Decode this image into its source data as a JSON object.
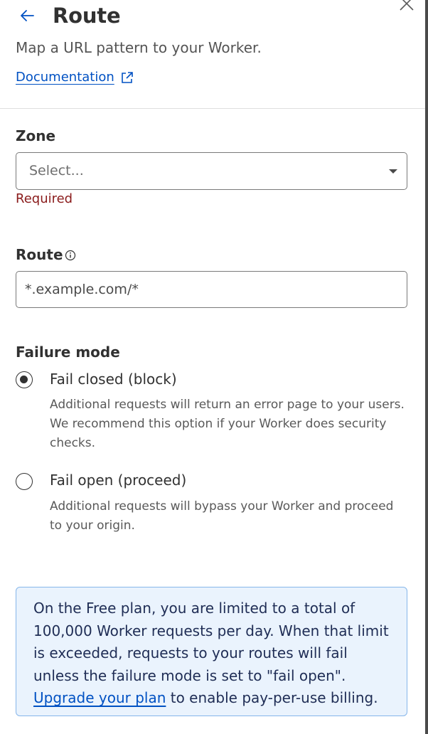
{
  "header": {
    "title": "Route",
    "subtitle": "Map a URL pattern to your Worker.",
    "documentation_link": "Documentation"
  },
  "zone": {
    "label": "Zone",
    "placeholder": "Select...",
    "error": "Required"
  },
  "route": {
    "label": "Route",
    "value": "",
    "placeholder": "*.example.com/*"
  },
  "failure_mode": {
    "label": "Failure mode",
    "selected": "fail-closed",
    "options": [
      {
        "label": "Fail closed (block)",
        "description": "Additional requests will return an error page to your users. We recommend this option if your Worker does security checks."
      },
      {
        "label": "Fail open (proceed)",
        "description": "Additional requests will bypass your Worker and proceed to your origin."
      }
    ]
  },
  "notice": {
    "text_before": "On the Free plan, you are limited to a total of 100,000 Worker requests per day. When that limit is exceeded, requests to your routes will fail unless the failure mode is set to \"fail open\".",
    "link": "Upgrade your plan",
    "text_after": " to enable pay-per-use billing."
  },
  "colors": {
    "accent": "#0051c3",
    "error": "#8a1b1b",
    "notice_background": "#eaf3fd",
    "notice_border": "#86b6ea"
  },
  "icons": {
    "back": "arrow-left-icon",
    "close": "close-icon",
    "external": "external-link-icon",
    "caret": "caret-down-icon",
    "info": "info-icon"
  }
}
